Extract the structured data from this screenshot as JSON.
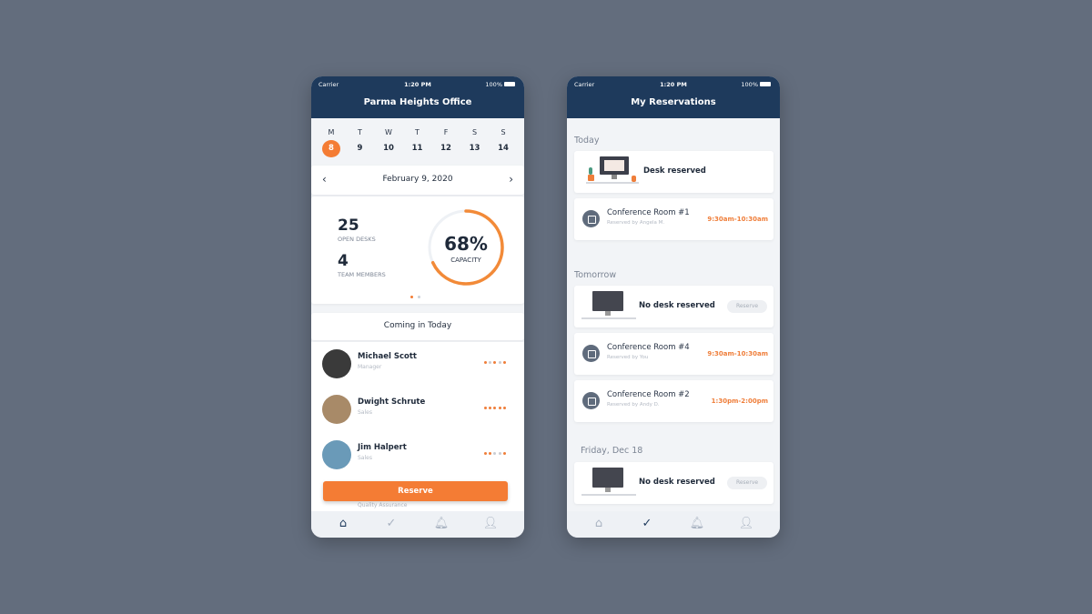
{
  "colors": {
    "header": "#1e3a5c",
    "accent": "#f47c34",
    "background": "#636d7d"
  },
  "status": {
    "carrier": "Carrier",
    "time": "1:20 PM",
    "battery": "100%"
  },
  "home": {
    "title": "Parma Heights Office",
    "week": [
      {
        "d": "M",
        "n": "8",
        "selected": true
      },
      {
        "d": "T",
        "n": "9"
      },
      {
        "d": "W",
        "n": "10"
      },
      {
        "d": "T",
        "n": "11"
      },
      {
        "d": "F",
        "n": "12"
      },
      {
        "d": "S",
        "n": "13"
      },
      {
        "d": "S",
        "n": "14"
      }
    ],
    "date": "February 9, 2020",
    "open_desks": "25",
    "open_desks_label": "OPEN DESKS",
    "team_members": "4",
    "team_members_label": "TEAM MEMBERS",
    "capacity": "68%",
    "capacity_value": 68,
    "capacity_label": "CAPACITY",
    "coming_title": "Coming in Today",
    "people": [
      {
        "name": "Michael Scott",
        "role": "Manager",
        "dots": [
          1,
          0,
          1,
          0,
          1
        ],
        "avatar_color": "#3a3a3a"
      },
      {
        "name": "Dwight Schrute",
        "role": "Sales",
        "dots": [
          1,
          1,
          1,
          1,
          1
        ],
        "avatar_color": "#a88a68"
      },
      {
        "name": "Jim Halpert",
        "role": "Sales",
        "dots": [
          1,
          1,
          0,
          0,
          1
        ],
        "avatar_color": "#6a9ab8"
      }
    ],
    "partial_role": "Quality Assurance",
    "reserve_label": "Reserve"
  },
  "reservations": {
    "title": "My Reservations",
    "today_label": "Today",
    "tomorrow_label": "Tomorrow",
    "friday_label": "Friday, Dec 18",
    "desk_reserved": "Desk reserved",
    "no_desk": "No desk reserved",
    "reserve_label": "Reserve",
    "rooms": [
      {
        "name": "Conference Room #1",
        "by": "Reserved by Angela M.",
        "time": "9:30am-10:30am"
      },
      {
        "name": "Conference Room #4",
        "by": "Reserved by You",
        "time": "9:30am-10:30am"
      },
      {
        "name": "Conference Room #2",
        "by": "Reserved by Andy D.",
        "time": "1:30pm-2:00pm"
      }
    ]
  }
}
